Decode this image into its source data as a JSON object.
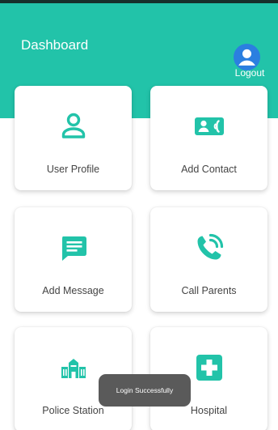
{
  "app": {
    "title": "Dashboard"
  },
  "header": {
    "logout_label": "Logout",
    "logout_icon": "account-circle-icon"
  },
  "colors": {
    "primary": "#22c3a9",
    "card_bg": "#ffffff",
    "label_text": "#444444",
    "toast_bg": "#5a5a5a"
  },
  "cards": [
    {
      "label": "User Profile",
      "icon": "user-icon"
    },
    {
      "label": "Add Contact",
      "icon": "contact-card-icon"
    },
    {
      "label": "Add Message",
      "icon": "message-icon"
    },
    {
      "label": "Call Parents",
      "icon": "phone-call-icon"
    },
    {
      "label": "Police Station",
      "icon": "building-icon"
    },
    {
      "label": "Hospital",
      "icon": "hospital-cross-icon"
    }
  ],
  "toast": {
    "text": "Login Successfully"
  }
}
